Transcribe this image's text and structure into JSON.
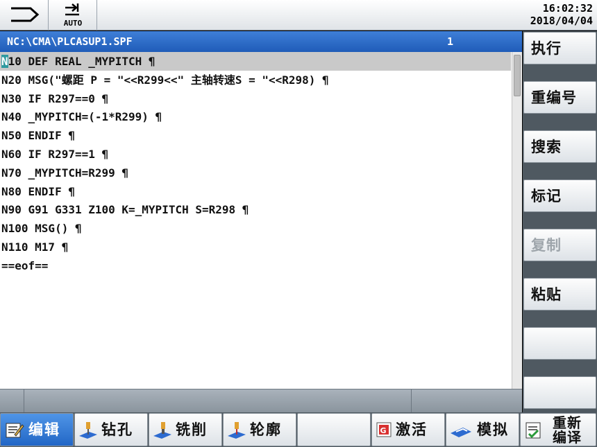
{
  "header": {
    "auto_label": "AUTO",
    "time": "16:02:32",
    "date": "2018/04/04"
  },
  "editor": {
    "path": "NC:\\CMA\\PLCASUP1.SPF",
    "line_number": "1",
    "cursor_char": "N",
    "lines": [
      "10 DEF REAL _MYPITCH ¶",
      "N20 MSG(\"螺距 P = \"<<R299<<\" 主轴转速S = \"<<R298) ¶",
      "N30 IF R297==0 ¶",
      "N40 _MYPITCH=(-1*R299) ¶",
      "N50 ENDIF ¶",
      "N60 IF R297==1 ¶",
      "N70 _MYPITCH=R299 ¶",
      "N80 ENDIF ¶",
      "N90 G91 G331 Z100 K=_MYPITCH S=R298 ¶",
      "N100 MSG() ¶",
      "N110 M17 ¶",
      "==eof=="
    ]
  },
  "vertical_softkeys": {
    "execute": "执行",
    "renumber": "重编号",
    "search": "搜索",
    "mark": "标记",
    "copy": "复制",
    "paste": "粘贴"
  },
  "horizontal_softkeys": {
    "edit": "编辑",
    "drill": "钻孔",
    "mill": "铣削",
    "contour": "轮廓",
    "activate": "激活",
    "simulate": "模拟",
    "recompile_1": "重新",
    "recompile_2": "编译"
  },
  "colors": {
    "title_bar": "#2c6cc9",
    "cursor": "#2f9aa0",
    "selected_line": "#c9c9c9",
    "softkey_bg": "#4f5961"
  },
  "icons": {
    "mode": "machine-mode-icon",
    "auto": "auto-mode-icon"
  }
}
